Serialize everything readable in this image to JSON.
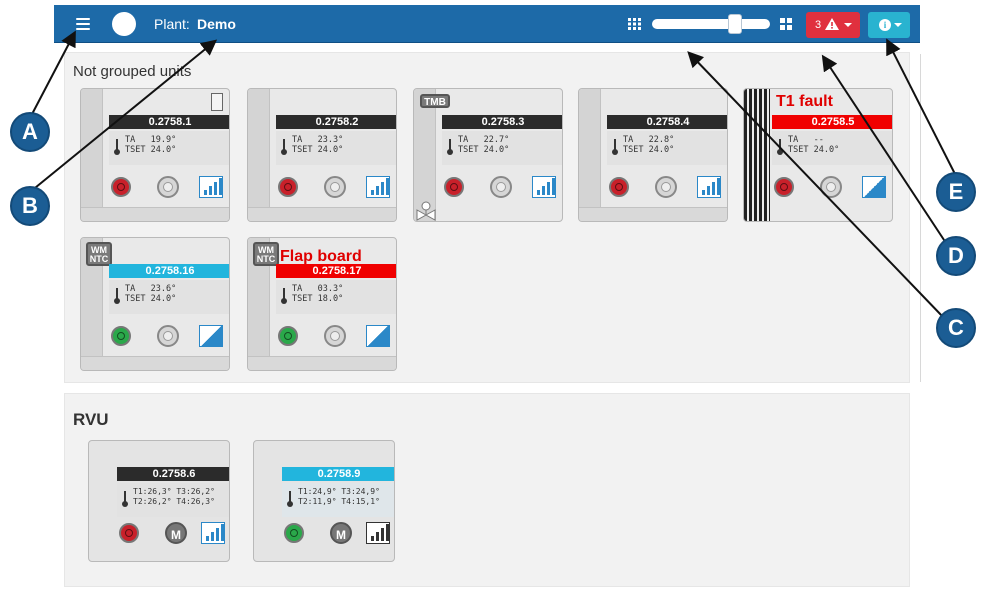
{
  "navbar": {
    "plant_label": "Plant:",
    "plant_name": "Demo",
    "alarm_count": "3",
    "colors": {
      "bar": "#1d6aa8",
      "alarm": "#e0303e",
      "info": "#29b3d0"
    },
    "icons": [
      "menu-icon",
      "cloud-logo-icon",
      "grid-9-icon",
      "grid-4-icon",
      "warning-icon",
      "info-icon"
    ]
  },
  "groups": [
    {
      "title": "Not grouped units",
      "units": [
        {
          "id": "0.2758.1",
          "ta_label": "TA",
          "ta": "19.9°",
          "tset_label": "TSET",
          "tset": "24.0°"
        },
        {
          "id": "0.2758.2",
          "ta_label": "TA",
          "ta": "23.3°",
          "tset_label": "TSET",
          "tset": "24.0°"
        },
        {
          "id": "0.2758.3",
          "ta_label": "TA",
          "ta": "22.7°",
          "tset_label": "TSET",
          "tset": "24.0°",
          "badge": "TMB"
        },
        {
          "id": "0.2758.4",
          "ta_label": "TA",
          "ta": "22.8°",
          "tset_label": "TSET",
          "tset": "24.0°"
        },
        {
          "id": "0.2758.5",
          "ta_label": "TA",
          "ta": "--",
          "tset_label": "TSET",
          "tset": "24.0°",
          "alert": "T1 fault"
        },
        {
          "id": "0.2758.16",
          "ta_label": "TA",
          "ta": "23.6°",
          "tset_label": "TSET",
          "tset": "24.0°",
          "badge_l1": "WM",
          "badge_l2": "NTC"
        },
        {
          "id": "0.2758.17",
          "ta_label": "TA",
          "ta": "03.3°",
          "tset_label": "TSET",
          "tset": "18.0°",
          "badge_l1": "WM",
          "badge_l2": "NTC",
          "alert": "Flap board"
        }
      ]
    },
    {
      "title": "RVU",
      "units": [
        {
          "id": "0.2758.6",
          "line1": "T1:26,3° T3:26,2°",
          "line2": "T2:26,2° T4:26,3°",
          "mode": "M"
        },
        {
          "id": "0.2758.9",
          "line1": "T1:24,9° T3:24,9°",
          "line2": "T2:11,9° T4:15,1°",
          "mode": "M"
        }
      ]
    }
  ],
  "callouts": [
    "A",
    "B",
    "C",
    "D",
    "E"
  ]
}
